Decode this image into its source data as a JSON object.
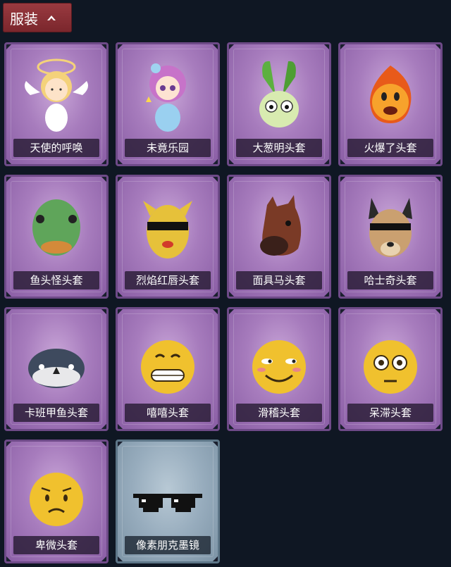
{
  "header": {
    "title": "服装"
  },
  "items": [
    {
      "name": "天使的呼唤",
      "icon": "angel-doll-icon",
      "rarity": "purple"
    },
    {
      "name": "未竟乐园",
      "icon": "pink-hair-doll-icon",
      "rarity": "purple"
    },
    {
      "name": "大葱明头套",
      "icon": "green-onion-head-icon",
      "rarity": "purple"
    },
    {
      "name": "火爆了头套",
      "icon": "fireball-head-icon",
      "rarity": "purple"
    },
    {
      "name": "鱼头怪头套",
      "icon": "fish-head-icon",
      "rarity": "purple"
    },
    {
      "name": "烈焰红唇头套",
      "icon": "yellow-mask-sunglasses-icon",
      "rarity": "purple"
    },
    {
      "name": "面具马头套",
      "icon": "horse-head-icon",
      "rarity": "purple"
    },
    {
      "name": "哈士奇头套",
      "icon": "husky-head-icon",
      "rarity": "purple"
    },
    {
      "name": "卡班甲鱼头套",
      "icon": "round-fish-head-icon",
      "rarity": "purple"
    },
    {
      "name": "嘻嘻头套",
      "icon": "grinning-emoji-head-icon",
      "rarity": "purple"
    },
    {
      "name": "滑稽头套",
      "icon": "smirk-emoji-head-icon",
      "rarity": "purple"
    },
    {
      "name": "呆滞头套",
      "icon": "flushed-emoji-head-icon",
      "rarity": "purple"
    },
    {
      "name": "卑微头套",
      "icon": "pleading-emoji-head-icon",
      "rarity": "purple"
    },
    {
      "name": "像素朋克墨镜",
      "icon": "pixel-sunglasses-icon",
      "rarity": "blue"
    }
  ]
}
